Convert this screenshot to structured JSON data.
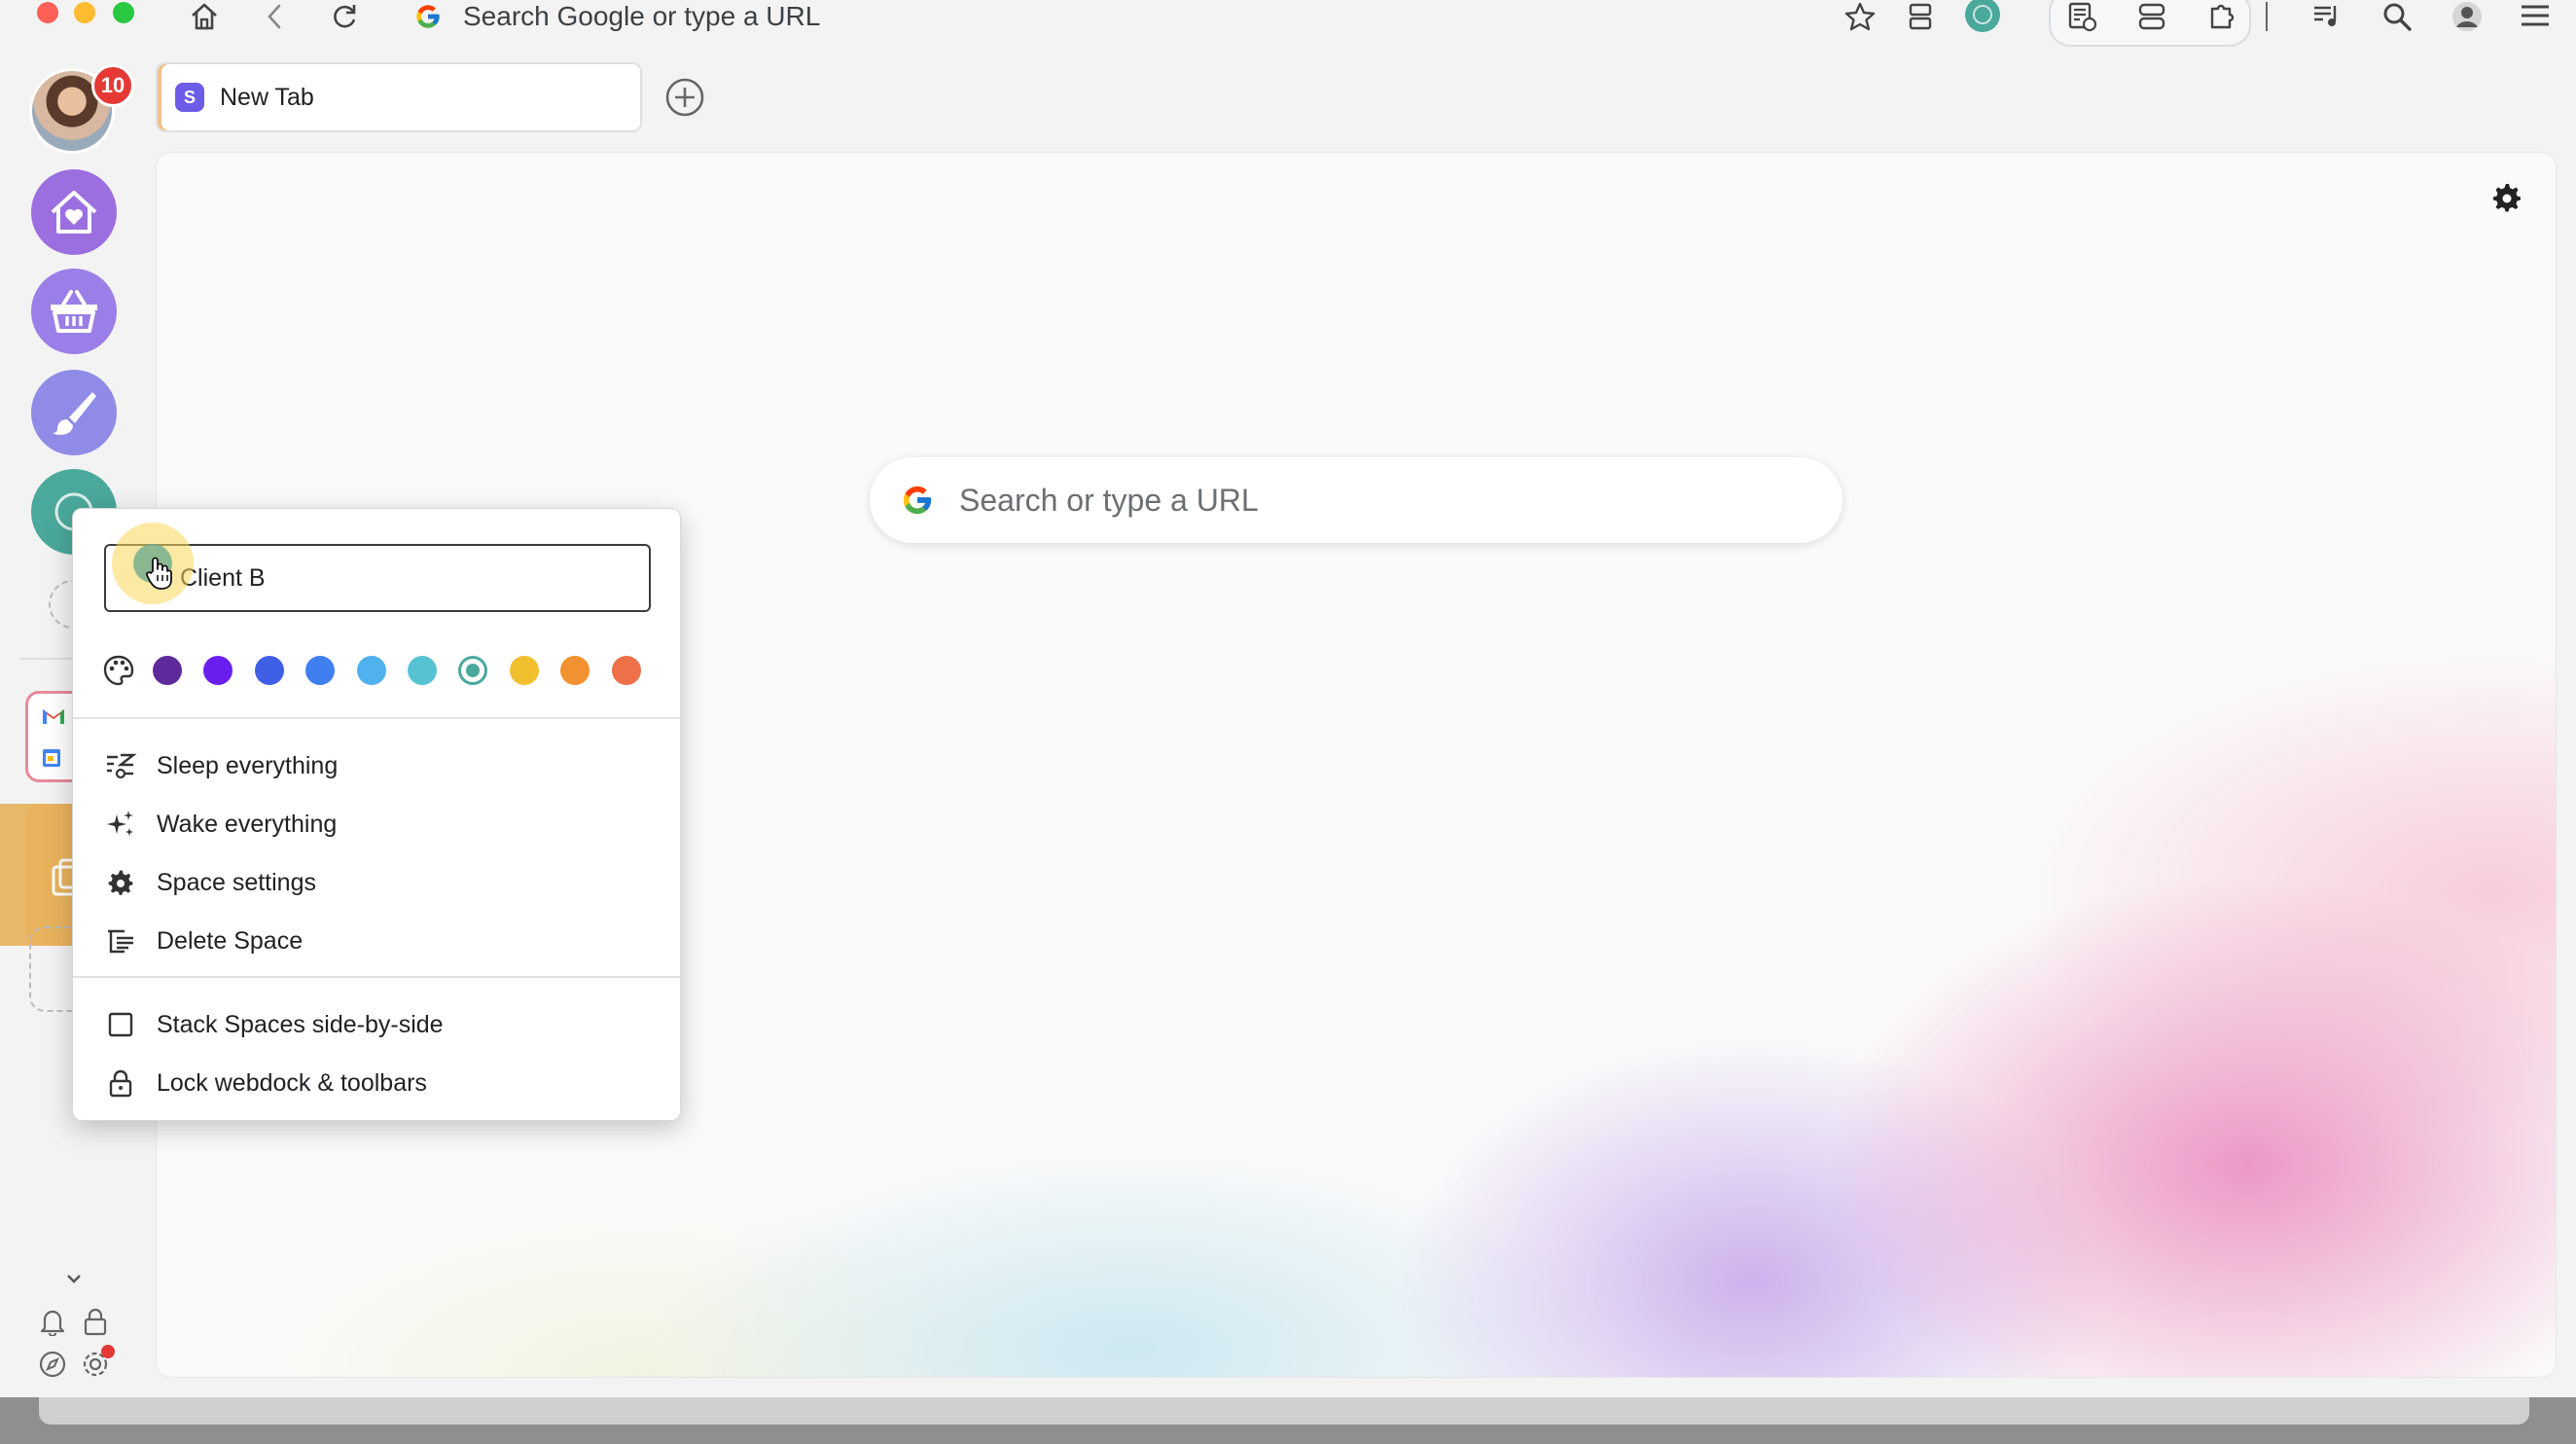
{
  "toolbar": {
    "omnibox_text": "Search Google or type a URL"
  },
  "sidebar": {
    "notification_count": "10",
    "spaces": [
      {
        "name": "home",
        "color": "#9b6fe0"
      },
      {
        "name": "shop",
        "color": "#9b7ee8"
      },
      {
        "name": "brush",
        "color": "#8f8be6"
      },
      {
        "name": "client",
        "color": "#4aa99b"
      }
    ]
  },
  "tabs": [
    {
      "label": "New Tab"
    }
  ],
  "main": {
    "search_placeholder": "Search or type a URL"
  },
  "menu": {
    "space_name": "Client B",
    "colors": [
      "#5e2a9b",
      "#6a1ff0",
      "#3f5fe6",
      "#3f7ff0",
      "#4fb1ee",
      "#57c3d2",
      "#4aa99b",
      "#f2c02e",
      "#f2912f",
      "#ee7048"
    ],
    "selected_color_index": 6,
    "items": [
      {
        "label": "Sleep everything",
        "icon": "sleep-icon"
      },
      {
        "label": "Wake everything",
        "icon": "sparkle-icon"
      },
      {
        "label": "Space settings",
        "icon": "gear-icon"
      },
      {
        "label": "Delete Space",
        "icon": "delete-space-icon"
      }
    ],
    "options": [
      {
        "label": "Stack Spaces side-by-side",
        "icon": "checkbox-icon"
      },
      {
        "label": "Lock webdock & toolbars",
        "icon": "lock-icon"
      }
    ]
  }
}
